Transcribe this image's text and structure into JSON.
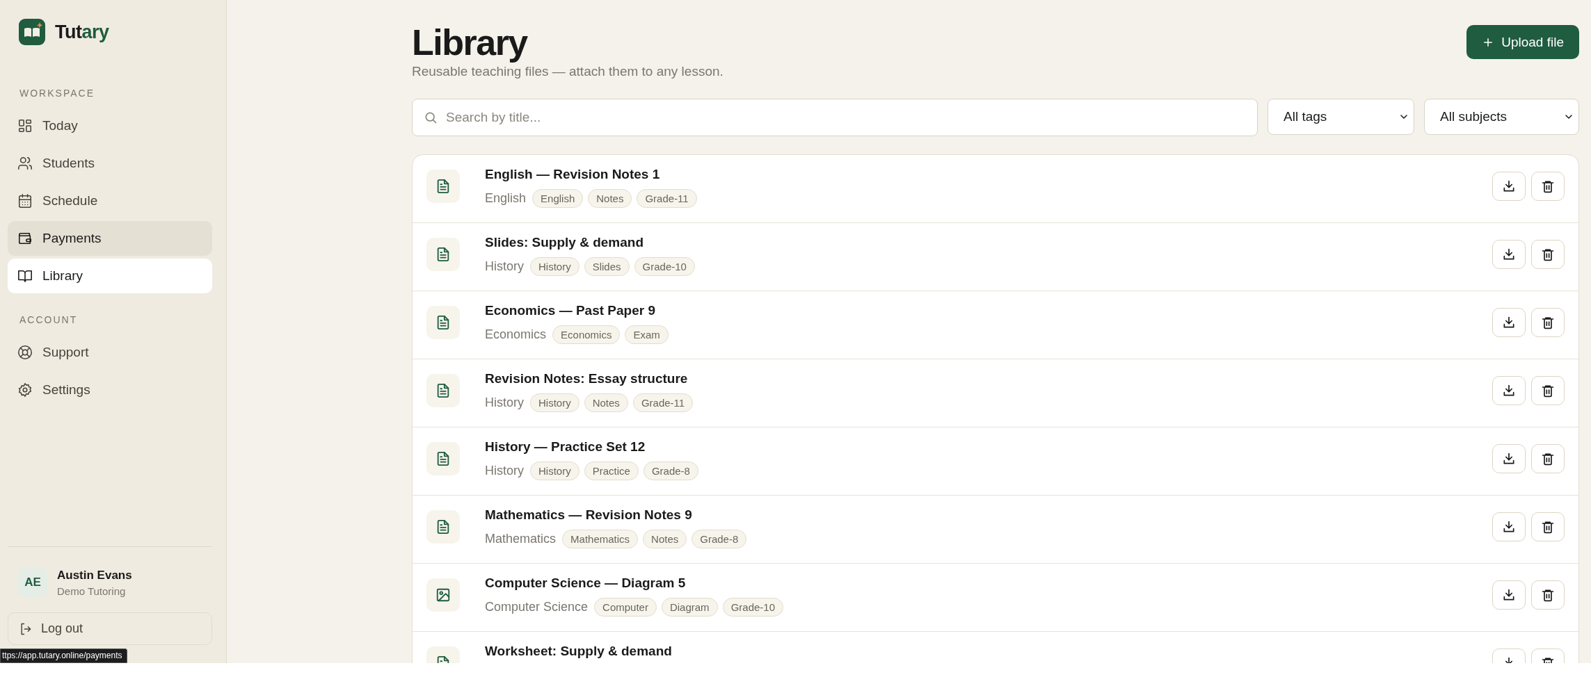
{
  "brand": {
    "name_start": "Tut",
    "name_end": "ary"
  },
  "sidebar": {
    "sections": [
      {
        "heading": "WORKSPACE",
        "items": [
          {
            "label": "Today",
            "kind": "grid",
            "selected": false,
            "hovered": false
          },
          {
            "label": "Students",
            "kind": "users",
            "selected": false,
            "hovered": false
          },
          {
            "label": "Schedule",
            "kind": "calendar",
            "selected": false,
            "hovered": false
          },
          {
            "label": "Payments",
            "kind": "wallet",
            "selected": false,
            "hovered": true
          },
          {
            "label": "Library",
            "kind": "book",
            "selected": true,
            "hovered": false
          }
        ]
      },
      {
        "heading": "ACCOUNT",
        "items": [
          {
            "label": "Support",
            "kind": "lifebuoy",
            "selected": false,
            "hovered": false
          },
          {
            "label": "Settings",
            "kind": "gear",
            "selected": false,
            "hovered": false
          }
        ]
      }
    ],
    "user": {
      "initials": "AE",
      "name": "Austin Evans",
      "org": "Demo Tutoring"
    },
    "logout": "Log out"
  },
  "status_url": "ttps://app.tutary.online/payments",
  "header": {
    "title": "Library",
    "subtitle": "Reusable teaching files — attach them to any lesson.",
    "upload_button": "Upload file"
  },
  "filters": {
    "search": {
      "placeholder": "Search by title..."
    },
    "tags": "All tags",
    "subjects": "All subjects"
  },
  "files": [
    {
      "kind": "document",
      "title": "English — Revision Notes 1",
      "subject": "English",
      "tags": [
        "English",
        "Notes",
        "Grade-11"
      ]
    },
    {
      "kind": "document",
      "title": "Slides: Supply & demand",
      "subject": "History",
      "tags": [
        "History",
        "Slides",
        "Grade-10"
      ]
    },
    {
      "kind": "document",
      "title": "Economics — Past Paper 9",
      "subject": "Economics",
      "tags": [
        "Economics",
        "Exam"
      ]
    },
    {
      "kind": "document",
      "title": "Revision Notes: Essay structure",
      "subject": "History",
      "tags": [
        "History",
        "Notes",
        "Grade-11"
      ]
    },
    {
      "kind": "document",
      "title": "History — Practice Set 12",
      "subject": "History",
      "tags": [
        "History",
        "Practice",
        "Grade-8"
      ]
    },
    {
      "kind": "document",
      "title": "Mathematics — Revision Notes 9",
      "subject": "Mathematics",
      "tags": [
        "Mathematics",
        "Notes",
        "Grade-8"
      ]
    },
    {
      "kind": "image",
      "title": "Computer Science — Diagram 5",
      "subject": "Computer Science",
      "tags": [
        "Computer",
        "Diagram",
        "Grade-10"
      ]
    },
    {
      "kind": "document",
      "title": "Worksheet: Supply & demand"
    }
  ]
}
